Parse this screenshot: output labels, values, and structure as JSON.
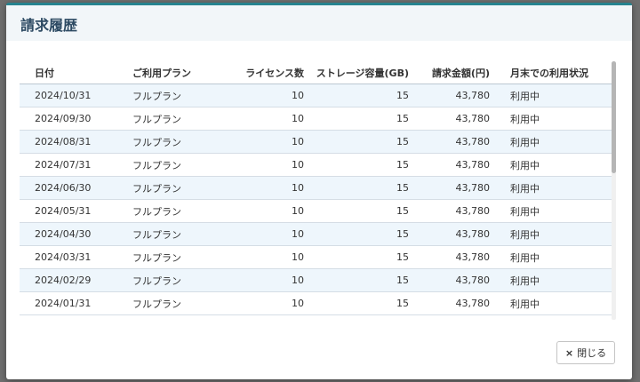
{
  "dialog": {
    "title": "請求履歴",
    "close_label": "閉じる",
    "close_icon": "×"
  },
  "table": {
    "columns": [
      "日付",
      "ご利用プラン",
      "ライセンス数",
      "ストレージ容量(GB)",
      "請求金額(円)",
      "月末での利用状況"
    ],
    "rows": [
      [
        "2024/10/31",
        "フルプラン",
        "10",
        "15",
        "43,780",
        "利用中"
      ],
      [
        "2024/09/30",
        "フルプラン",
        "10",
        "15",
        "43,780",
        "利用中"
      ],
      [
        "2024/08/31",
        "フルプラン",
        "10",
        "15",
        "43,780",
        "利用中"
      ],
      [
        "2024/07/31",
        "フルプラン",
        "10",
        "15",
        "43,780",
        "利用中"
      ],
      [
        "2024/06/30",
        "フルプラン",
        "10",
        "15",
        "43,780",
        "利用中"
      ],
      [
        "2024/05/31",
        "フルプラン",
        "10",
        "15",
        "43,780",
        "利用中"
      ],
      [
        "2024/04/30",
        "フルプラン",
        "10",
        "15",
        "43,780",
        "利用中"
      ],
      [
        "2024/03/31",
        "フルプラン",
        "10",
        "15",
        "43,780",
        "利用中"
      ],
      [
        "2024/02/29",
        "フルプラン",
        "10",
        "15",
        "43,780",
        "利用中"
      ],
      [
        "2024/01/31",
        "フルプラン",
        "10",
        "15",
        "43,780",
        "利用中"
      ]
    ]
  },
  "colors": {
    "accent": "#26838f",
    "title": "#2d4a63",
    "row_stripe": "#eef6fc"
  }
}
